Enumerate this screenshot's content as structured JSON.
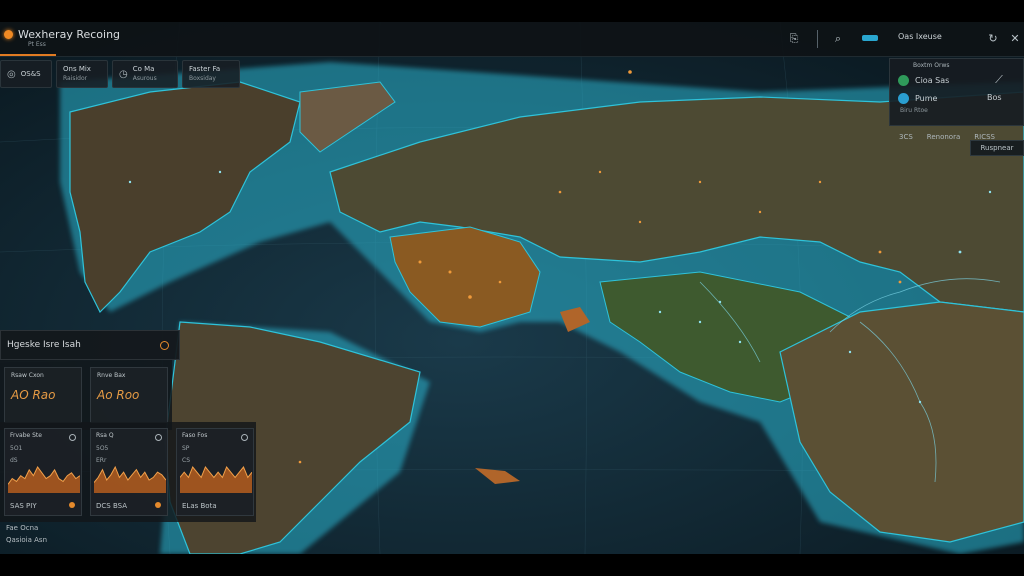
{
  "app": {
    "title": "Wexheray Recoing",
    "subtitle": "Pt Ess"
  },
  "toolbar": {
    "label": "Oas Ixeuse"
  },
  "chips": [
    {
      "icon": "globe-icon",
      "text": "OS&S"
    },
    {
      "line1": "Ons Mix",
      "line2": "Raisidor"
    },
    {
      "icon": "clock-icon",
      "line1": "Co Ma",
      "line2": "Asurous"
    },
    {
      "line1": "Faster Fa",
      "line2": "Boxsiday"
    }
  ],
  "right_panel": {
    "title": "Boxtm Orws",
    "rows": [
      {
        "label": "Cioa Sas",
        "extra": "",
        "color": "#2f9a5a"
      },
      {
        "label": "Pume",
        "extra": "Bos",
        "color": "#2a9ed0"
      }
    ],
    "sub": "Biru Rtoe",
    "footer": [
      "3CS",
      "Renonora",
      "RICSS"
    ],
    "button": "Ruspnear"
  },
  "left_panel": {
    "title": "Hgeske Isre Isah",
    "stats": [
      {
        "label": "Rsaw Cxon",
        "value": "AO Rao"
      },
      {
        "label": "Rnve Bax",
        "value": "Ao Roo"
      }
    ],
    "minis": [
      {
        "label": "Frvabe Ste",
        "num": "5O1",
        "sub": "dS",
        "foot": "SAS PIY",
        "values": [
          3,
          5,
          4,
          6,
          5,
          8,
          6,
          9,
          7,
          5,
          6,
          8,
          5,
          4,
          6,
          7,
          5,
          6
        ]
      },
      {
        "label": "Rsa Q",
        "num": "5O5",
        "sub": "ERr",
        "foot": "DCS BSA",
        "values": [
          4,
          6,
          9,
          5,
          7,
          10,
          6,
          8,
          5,
          7,
          9,
          6,
          8,
          5,
          6,
          8,
          7,
          5
        ]
      },
      {
        "label": "Faso Fos",
        "num": "SP",
        "sub": "CS",
        "foot": "ELas Bota",
        "values": [
          3,
          4,
          3,
          5,
          4,
          3,
          5,
          4,
          3,
          4,
          3,
          5,
          4,
          3,
          4,
          5,
          3,
          4
        ]
      }
    ],
    "footer": [
      "Fae Ocna",
      "Qasioia  Asn"
    ]
  },
  "colors": {
    "accent": "#e58a2c",
    "cyan": "#29a6cf",
    "panel": "#161c21"
  }
}
